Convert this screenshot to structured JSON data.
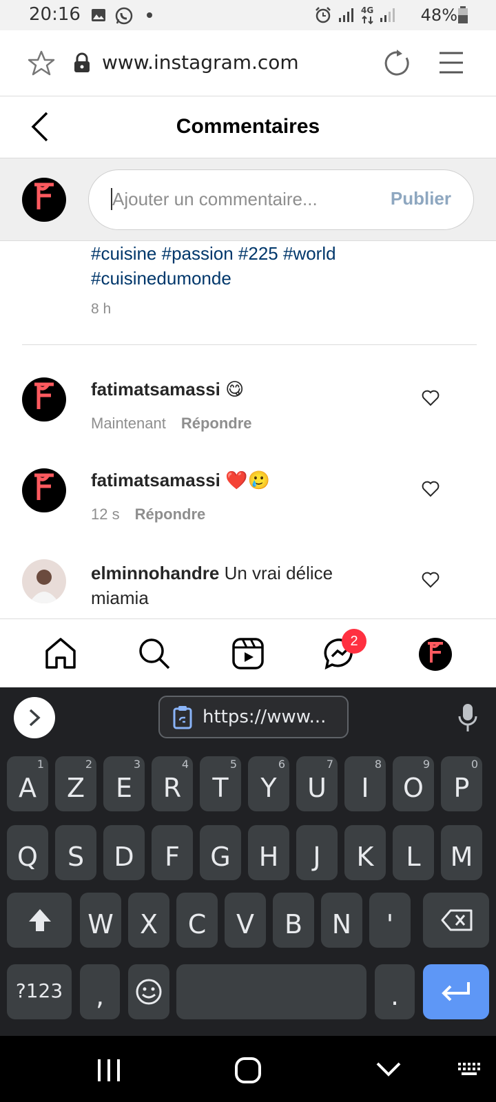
{
  "status_bar": {
    "time": "20:16",
    "network": "4G",
    "battery": "48%"
  },
  "browser": {
    "url": "www.instagram.com"
  },
  "header": {
    "title": "Commentaires"
  },
  "compose": {
    "placeholder": "Ajouter un commentaire...",
    "publish_label": "Publier"
  },
  "caption": {
    "hashtags_line1": "#cuisine #passion #225 #world",
    "hashtags_line2": "#cuisinedumonde",
    "time": "8 h"
  },
  "comments": [
    {
      "username": "fatimatsamassi",
      "text": "😋",
      "time": "Maintenant",
      "reply_label": "Répondre"
    },
    {
      "username": "fatimatsamassi",
      "text": "❤️🥲",
      "time": "12 s",
      "reply_label": "Répondre"
    },
    {
      "username": "elminnohandre",
      "text": "Un vrai délice",
      "text2": "miamia"
    }
  ],
  "nav": {
    "messages_badge": "2"
  },
  "keyboard": {
    "clipboard": "https://www...",
    "row1": [
      "A",
      "Z",
      "E",
      "R",
      "T",
      "Y",
      "U",
      "I",
      "O",
      "P"
    ],
    "row1_nums": [
      "1",
      "2",
      "3",
      "4",
      "5",
      "6",
      "7",
      "8",
      "9",
      "0"
    ],
    "row2": [
      "Q",
      "S",
      "D",
      "F",
      "G",
      "H",
      "J",
      "K",
      "L",
      "M"
    ],
    "row3": [
      "W",
      "X",
      "C",
      "V",
      "B",
      "N",
      "'"
    ],
    "symbols": "?123",
    "comma": ",",
    "period": "."
  },
  "colors": {
    "accent_blue": "#00376b",
    "publish_disabled": "#8ea7c0",
    "badge_red": "#ff3040",
    "enter_key": "#5e97f6"
  }
}
